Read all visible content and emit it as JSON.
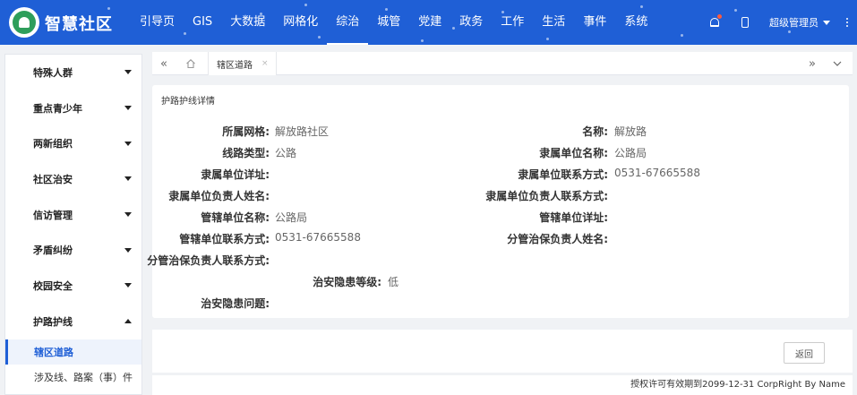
{
  "header": {
    "brand": "智慧社区",
    "nav": [
      {
        "label": "引导页",
        "active": false
      },
      {
        "label": "GIS",
        "active": false
      },
      {
        "label": "大数据",
        "active": false
      },
      {
        "label": "网格化",
        "active": false
      },
      {
        "label": "综治",
        "active": true
      },
      {
        "label": "城管",
        "active": false
      },
      {
        "label": "党建",
        "active": false
      },
      {
        "label": "政务",
        "active": false
      },
      {
        "label": "工作",
        "active": false
      },
      {
        "label": "生活",
        "active": false
      },
      {
        "label": "事件",
        "active": false
      },
      {
        "label": "系统",
        "active": false
      }
    ],
    "user": "超级管理员",
    "colors": {
      "bar": "#1f5fd6",
      "notice_dot": "#ff5a3c"
    }
  },
  "sidebar": {
    "items": [
      {
        "label": "特殊人群",
        "expanded": false
      },
      {
        "label": "重点青少年",
        "expanded": false
      },
      {
        "label": "两新组织",
        "expanded": false
      },
      {
        "label": "社区治安",
        "expanded": false
      },
      {
        "label": "信访管理",
        "expanded": false
      },
      {
        "label": "矛盾纠纷",
        "expanded": false
      },
      {
        "label": "校园安全",
        "expanded": false
      },
      {
        "label": "护路护线",
        "expanded": true
      }
    ],
    "sub_items": [
      {
        "label": "辖区道路",
        "active": true
      },
      {
        "label": "涉及线、路案（事）件",
        "active": false
      }
    ]
  },
  "tabs": {
    "open": [
      {
        "label": "辖区道路",
        "close": "×"
      }
    ],
    "nav_left": "«",
    "nav_right": "»"
  },
  "detail": {
    "title": "护路护线详情",
    "fields": {
      "grid": {
        "label": "所属网格:",
        "value": "解放路社区"
      },
      "name": {
        "label": "名称:",
        "value": "解放路"
      },
      "line_type": {
        "label": "线路类型:",
        "value": "公路"
      },
      "owner_unit": {
        "label": "隶属单位名称:",
        "value": "公路局"
      },
      "owner_addr": {
        "label": "隶属单位详址:",
        "value": ""
      },
      "owner_phone": {
        "label": "隶属单位联系方式:",
        "value": "0531-67665588"
      },
      "owner_leader": {
        "label": "隶属单位负责人姓名:",
        "value": ""
      },
      "owner_leader_phone": {
        "label": "隶属单位负责人联系方式:",
        "value": ""
      },
      "admin_unit": {
        "label": "管辖单位名称:",
        "value": "公路局"
      },
      "admin_addr": {
        "label": "管辖单位详址:",
        "value": ""
      },
      "admin_phone": {
        "label": "管辖单位联系方式:",
        "value": "0531-67665588"
      },
      "security_leader": {
        "label": "分管治保负责人姓名:",
        "value": ""
      },
      "security_leader_phone": {
        "label": "分管治保负责人联系方式:",
        "value": ""
      },
      "hazard_level": {
        "label": "治安隐患等级:",
        "value": "低"
      },
      "hazard_issue": {
        "label": "治安隐患问题:",
        "value": ""
      }
    }
  },
  "actions": {
    "back": "返回"
  },
  "footer": {
    "copyright": "授权许可有效期到2099-12-31 CorpRight By Name"
  }
}
